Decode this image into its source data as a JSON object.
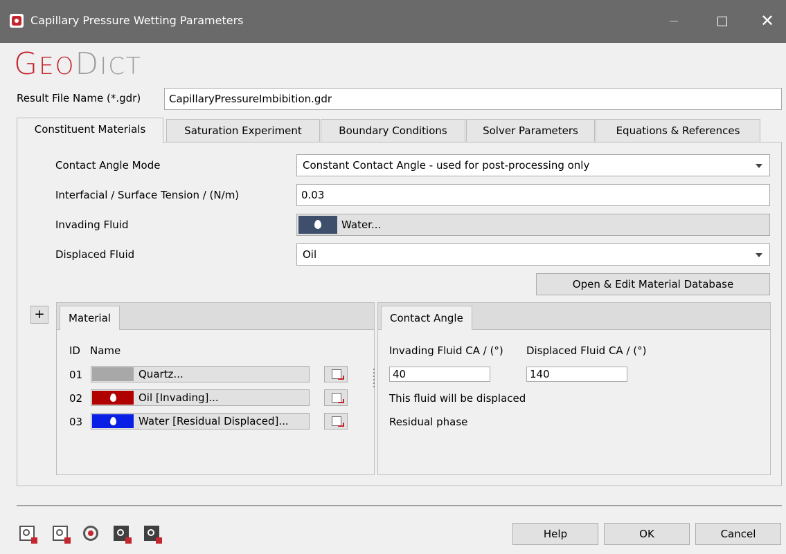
{
  "window": {
    "title": "Capillary Pressure Wetting Parameters"
  },
  "logo": {
    "first_big": "G",
    "first_rest": "EO",
    "second_big": "D",
    "second_rest": "ICT"
  },
  "result_file": {
    "label": "Result File Name (*.gdr)",
    "value": "CapillaryPressureImbibition.gdr"
  },
  "tabs": [
    {
      "label": "Constituent Materials"
    },
    {
      "label": "Saturation Experiment"
    },
    {
      "label": "Boundary Conditions"
    },
    {
      "label": "Solver Parameters"
    },
    {
      "label": "Equations & References"
    }
  ],
  "form": {
    "contact_angle_mode": {
      "label": "Contact Angle Mode",
      "value": "Constant Contact Angle - used for post-processing only"
    },
    "tension": {
      "label": "Interfacial / Surface Tension / (N/m)",
      "value": "0.03"
    },
    "invading_fluid": {
      "label": "Invading Fluid",
      "value": "Water...",
      "color": "#3d4f6b"
    },
    "displaced_fluid": {
      "label": "Displaced Fluid",
      "value": "Oil"
    },
    "open_db_button": "Open & Edit Material Database"
  },
  "plus_button": "+",
  "material_panel": {
    "tab": "Material",
    "col_id": "ID",
    "col_name": "Name",
    "rows": [
      {
        "id": "01",
        "name": "Quartz...",
        "color": "#a8a8a8",
        "icon": "none"
      },
      {
        "id": "02",
        "name": "Oil [Invading]...",
        "color": "#b00000",
        "icon": "drop-icon"
      },
      {
        "id": "03",
        "name": "Water [Residual Displaced]...",
        "color": "#0a1fe6",
        "icon": "drop-icon"
      }
    ]
  },
  "contact_panel": {
    "tab": "Contact Angle",
    "invading_label": "Invading Fluid CA / (°)",
    "displaced_label": "Displaced Fluid CA / (°)",
    "invading_value": "40",
    "displaced_value": "140",
    "note1": "This fluid will be displaced",
    "note2": "Residual phase"
  },
  "footer": {
    "help": "Help",
    "ok": "OK",
    "cancel": "Cancel"
  }
}
